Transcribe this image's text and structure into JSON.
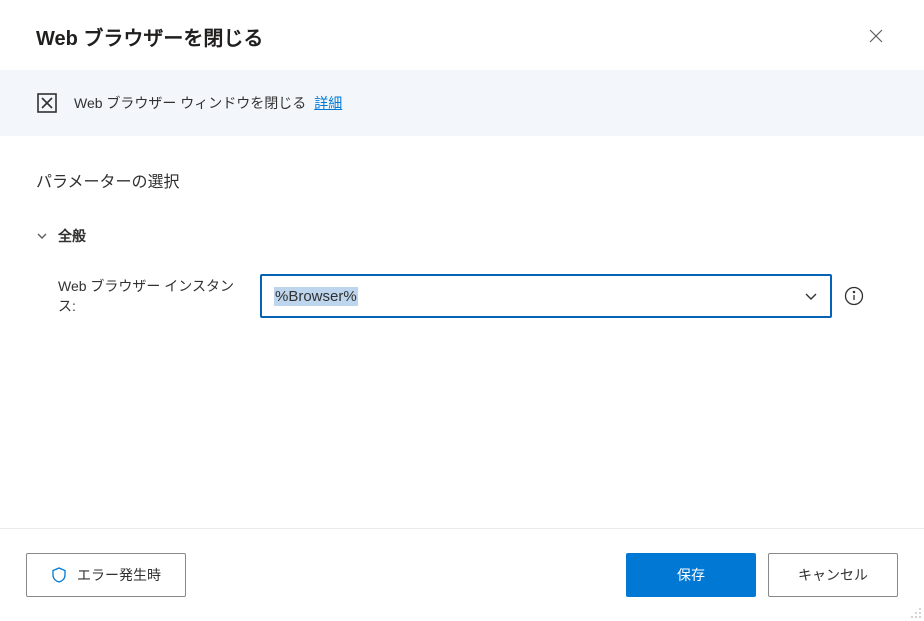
{
  "header": {
    "title": "Web ブラウザーを閉じる"
  },
  "banner": {
    "text": "Web ブラウザー ウィンドウを閉じる",
    "link": "詳細"
  },
  "content": {
    "section_title": "パラメーターの選択",
    "group_title": "全般",
    "fields": {
      "browser_instance": {
        "label": "Web ブラウザー インスタンス:",
        "value": "%Browser%"
      }
    }
  },
  "footer": {
    "error_btn": "エラー発生時",
    "save_btn": "保存",
    "cancel_btn": "キャンセル"
  }
}
